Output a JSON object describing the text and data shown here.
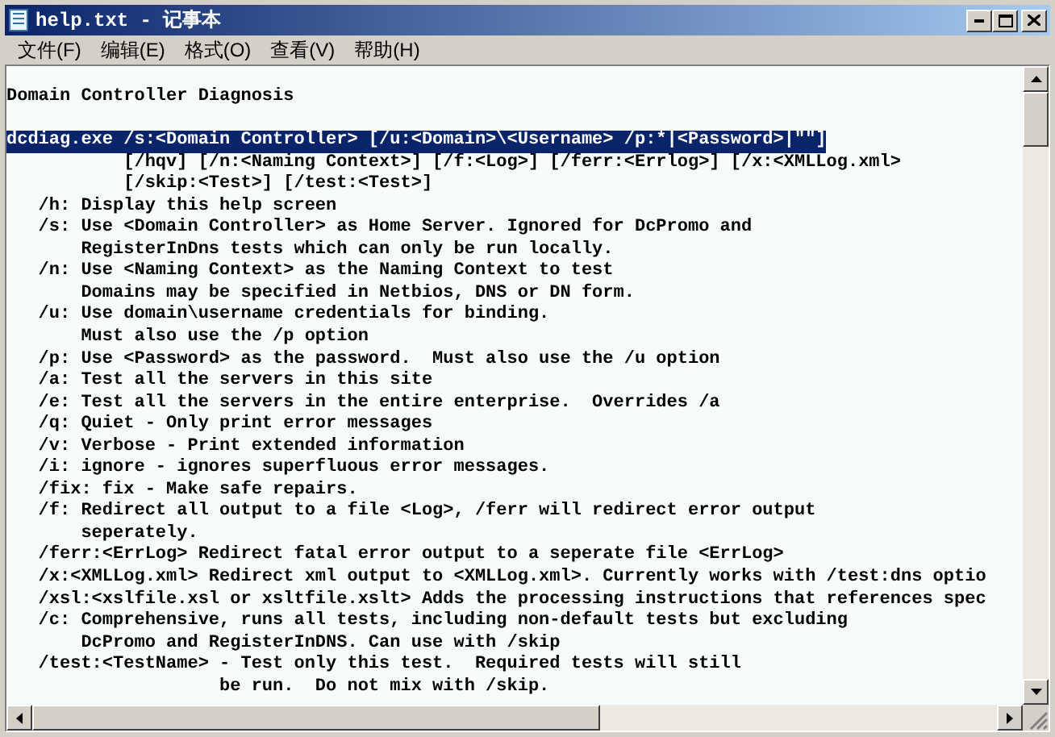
{
  "window": {
    "title": "help.txt - 记事本"
  },
  "menu": [
    "文件(F)",
    "编辑(E)",
    "格式(O)",
    "查看(V)",
    "帮助(H)"
  ],
  "document": {
    "heading": "Domain Controller Diagnosis",
    "lines": [
      {
        "text": "dcdiag.exe /s:<Domain Controller> [/u:<Domain>\\<Username> /p:*|<Password>|\"\"]",
        "selected": true
      },
      {
        "text": "           [/hqv] [/n:<Naming Context>] [/f:<Log>] [/ferr:<Errlog>] [/x:<XMLLog.xml>",
        "selected": false
      },
      {
        "text": "           [/skip:<Test>] [/test:<Test>]",
        "selected": false
      },
      {
        "text": "   /h: Display this help screen",
        "selected": false
      },
      {
        "text": "   /s: Use <Domain Controller> as Home Server. Ignored for DcPromo and",
        "selected": false
      },
      {
        "text": "       RegisterInDns tests which can only be run locally.",
        "selected": false
      },
      {
        "text": "   /n: Use <Naming Context> as the Naming Context to test",
        "selected": false
      },
      {
        "text": "       Domains may be specified in Netbios, DNS or DN form.",
        "selected": false
      },
      {
        "text": "   /u: Use domain\\username credentials for binding.",
        "selected": false
      },
      {
        "text": "       Must also use the /p option",
        "selected": false
      },
      {
        "text": "   /p: Use <Password> as the password.  Must also use the /u option",
        "selected": false
      },
      {
        "text": "   /a: Test all the servers in this site",
        "selected": false
      },
      {
        "text": "   /e: Test all the servers in the entire enterprise.  Overrides /a",
        "selected": false
      },
      {
        "text": "   /q: Quiet - Only print error messages",
        "selected": false
      },
      {
        "text": "   /v: Verbose - Print extended information",
        "selected": false
      },
      {
        "text": "   /i: ignore - ignores superfluous error messages.",
        "selected": false
      },
      {
        "text": "   /fix: fix - Make safe repairs.",
        "selected": false
      },
      {
        "text": "   /f: Redirect all output to a file <Log>, /ferr will redirect error output",
        "selected": false
      },
      {
        "text": "       seperately.",
        "selected": false
      },
      {
        "text": "   /ferr:<ErrLog> Redirect fatal error output to a seperate file <ErrLog>",
        "selected": false
      },
      {
        "text": "   /x:<XMLLog.xml> Redirect xml output to <XMLLog.xml>. Currently works with /test:dns optio",
        "selected": false
      },
      {
        "text": "   /xsl:<xslfile.xsl or xsltfile.xslt> Adds the processing instructions that references spec",
        "selected": false
      },
      {
        "text": "   /c: Comprehensive, runs all tests, including non-default tests but excluding",
        "selected": false
      },
      {
        "text": "       DcPromo and RegisterInDNS. Can use with /skip",
        "selected": false
      },
      {
        "text": "   /test:<TestName> - Test only this test.  Required tests will still",
        "selected": false
      },
      {
        "text": "                    be run.  Do not mix with /skip.",
        "selected": false
      }
    ]
  }
}
